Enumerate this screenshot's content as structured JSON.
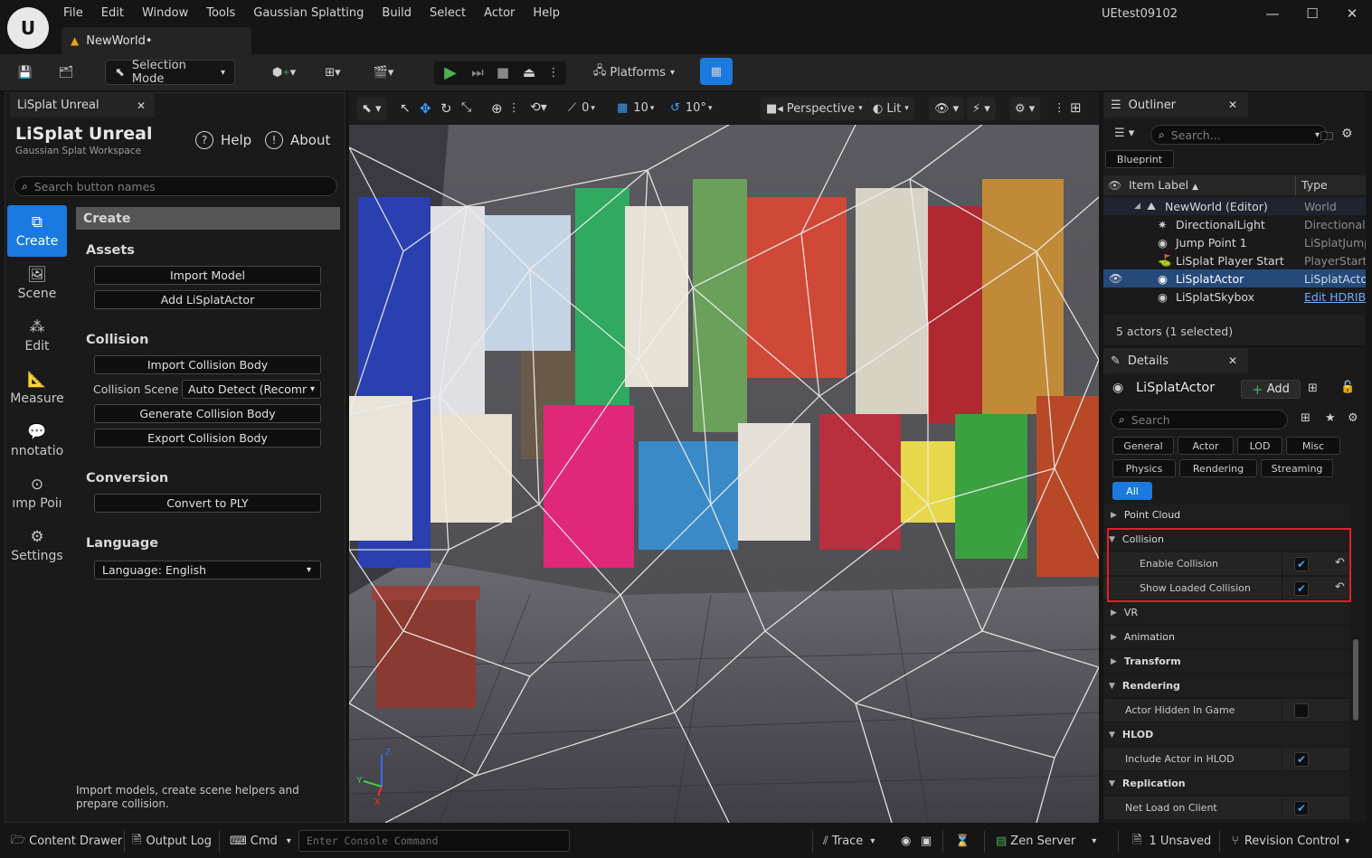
{
  "menu": [
    "File",
    "Edit",
    "Window",
    "Tools",
    "Gaussian Splatting",
    "Build",
    "Select",
    "Actor",
    "Help"
  ],
  "document_tab": "NewWorld•",
  "window_title": "UEtest09102",
  "toolbar": {
    "selection_mode": "Selection Mode",
    "platforms": "Platforms"
  },
  "left_panel": {
    "tab": "LiSplat Unreal",
    "title": "LiSplat Unreal",
    "subtitle": "Gaussian Splat Workspace",
    "help": "Help",
    "about": "About",
    "search_placeholder": "Search button names",
    "sidebar": [
      {
        "label": "Create",
        "icon": "create-icon",
        "active": true
      },
      {
        "label": "Scene",
        "icon": "image-icon"
      },
      {
        "label": "Edit",
        "icon": "edit-nodes-icon"
      },
      {
        "label": "Measure",
        "icon": "ruler-icon"
      },
      {
        "label": "nnotatio",
        "icon": "annotation-icon"
      },
      {
        "label": "ımp Poiı",
        "icon": "jump-point-icon"
      },
      {
        "label": "Settings",
        "icon": "settings-icon"
      }
    ],
    "create_header": "Create",
    "assets": {
      "title": "Assets",
      "buttons": [
        "Import Model",
        "Add LiSplatActor"
      ]
    },
    "collision": {
      "title": "Collision",
      "import": "Import Collision Body",
      "scene_label": "Collision Scene",
      "scene_value": "Auto Detect (Recomr",
      "generate": "Generate Collision Body",
      "export": "Export Collision Body"
    },
    "conversion": {
      "title": "Conversion",
      "button": "Convert to PLY"
    },
    "language": {
      "title": "Language",
      "value": "Language: English"
    },
    "footer": "Import models, create scene helpers and prepare collision."
  },
  "viewport": {
    "snap_move": "0",
    "snap_grid": "10",
    "snap_rot": "10°",
    "view_mode": "Perspective",
    "lighting": "Lit",
    "axis_z": "Z",
    "axis_x": "X",
    "axis_y": "Y"
  },
  "outliner": {
    "tab": "Outliner",
    "search_placeholder": "Search...",
    "blueprint_btn": "Blueprint",
    "col_label": "Item Label",
    "col_type": "Type",
    "rows": [
      {
        "label": "NewWorld (Editor)",
        "type": "World",
        "indent": 1
      },
      {
        "label": "DirectionalLight",
        "type": "DirectionalL",
        "indent": 2
      },
      {
        "label": "Jump Point 1",
        "type": "LiSplatJump",
        "indent": 2
      },
      {
        "label": "LiSplat Player Start",
        "type": "PlayerStart",
        "indent": 2
      },
      {
        "label": "LiSplatActor",
        "type": "LiSplatActor",
        "indent": 2,
        "selected": true
      },
      {
        "label": "LiSplatSkybox",
        "type": "Edit HDRIBa",
        "indent": 2,
        "link": true
      }
    ],
    "status": "5 actors (1 selected)"
  },
  "details": {
    "tab": "Details",
    "actor": "LiSplatActor",
    "add": "Add",
    "search_placeholder": "Search",
    "filters_row1": [
      "General",
      "Actor",
      "LOD",
      "Misc"
    ],
    "filters_row2": [
      "Physics",
      "Rendering",
      "Streaming"
    ],
    "filter_active": "All",
    "rows": [
      {
        "kind": "cat-collapsed",
        "label": "Point Cloud"
      },
      {
        "kind": "cat-open",
        "label": "Collision"
      },
      {
        "kind": "prop",
        "label": "Enable Collision",
        "checked": true,
        "reset": true
      },
      {
        "kind": "prop",
        "label": "Show Loaded Collision",
        "checked": true,
        "reset": true
      },
      {
        "kind": "cat-collapsed",
        "label": "VR"
      },
      {
        "kind": "cat-collapsed",
        "label": "Animation"
      },
      {
        "kind": "cat-collapsed",
        "label": "Transform"
      },
      {
        "kind": "cat-open",
        "label": "Rendering"
      },
      {
        "kind": "prop",
        "label": "Actor Hidden In Game",
        "checked": false
      },
      {
        "kind": "cat-open",
        "label": "HLOD"
      },
      {
        "kind": "prop",
        "label": "Include Actor in HLOD",
        "checked": true
      },
      {
        "kind": "cat-open",
        "label": "Replication"
      },
      {
        "kind": "prop",
        "label": "Net Load on Client",
        "checked": true
      }
    ]
  },
  "statusbar": {
    "content_drawer": "Content Drawer",
    "output_log": "Output Log",
    "cmd": "Cmd",
    "console_placeholder": "Enter Console Command",
    "trace": "Trace",
    "zen_server": "Zen Server",
    "unsaved": "1 Unsaved",
    "revision_control": "Revision Control"
  },
  "colors": {
    "accent": "#1a7ae0",
    "highlight_box": "#e0202a",
    "background": "#151515",
    "panel": "#1a1a1a"
  }
}
